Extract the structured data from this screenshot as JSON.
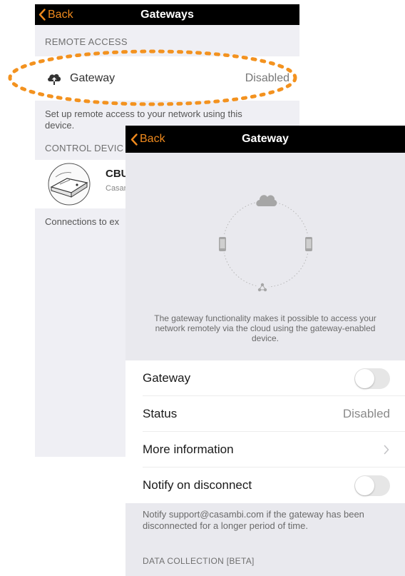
{
  "gateways_screen": {
    "back_label": "Back",
    "title": "Gateways",
    "remote_access_header": "REMOTE ACCESS",
    "gateway_row": {
      "icon": "cloud-upload-icon",
      "label": "Gateway",
      "value": "Disabled"
    },
    "remote_access_note": "Set up remote access to your network using this device.",
    "control_device_header": "CONTROL DEVIC",
    "device": {
      "name": "CBU",
      "subtitle": "Casar"
    },
    "connections_note": "Connections to ex"
  },
  "gateway_screen": {
    "back_label": "Back",
    "title": "Gateway",
    "illustration_icons": [
      "cloud-icon",
      "phone-icon",
      "phone-icon",
      "network-icon"
    ],
    "description": "The gateway functionality makes it possible to access your network remotely via the cloud using the gateway-enabled device.",
    "settings": {
      "gateway_label": "Gateway",
      "gateway_enabled": false,
      "status_label": "Status",
      "status_value": "Disabled",
      "more_info_label": "More information",
      "notify_label": "Notify on disconnect",
      "notify_enabled": false
    },
    "notify_note": "Notify support@casambi.com if the gateway has been disconnected for a longer period of time.",
    "data_collection_header": "DATA COLLECTION [BETA]"
  },
  "colors": {
    "accent": "#f08a1d",
    "navbar": "#000000",
    "highlight_ring": "#f3921f"
  }
}
